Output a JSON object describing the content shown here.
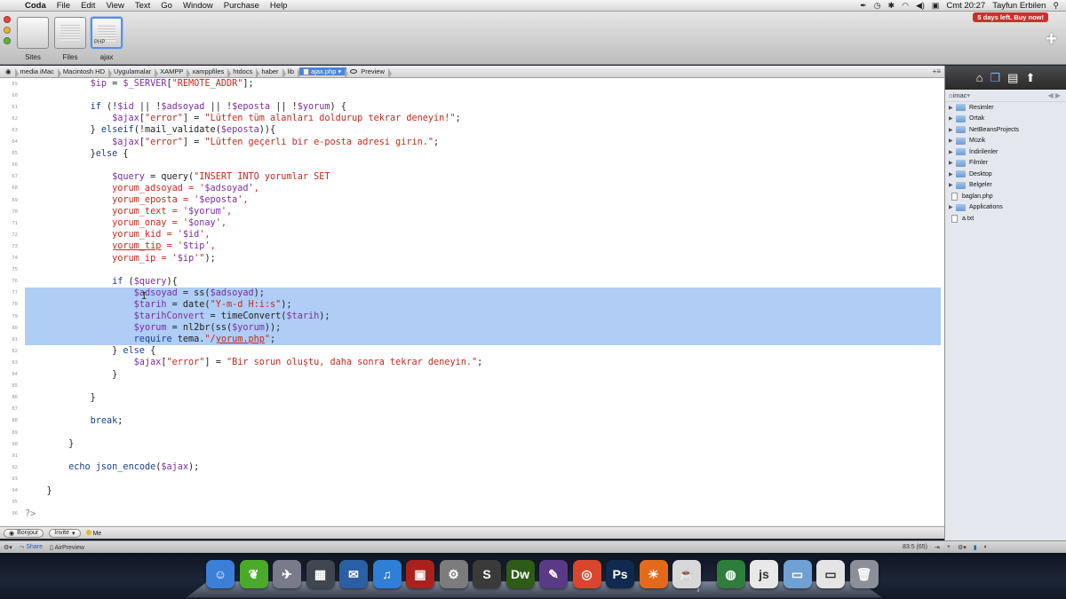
{
  "menubar": {
    "apple": "",
    "items": [
      "Coda",
      "File",
      "Edit",
      "View",
      "Text",
      "Go",
      "Window",
      "Purchase",
      "Help"
    ],
    "clock": "Cmt 20:27",
    "user": "Tayfun Erbilen"
  },
  "toolbar": {
    "sites": [
      {
        "label": "Sites"
      },
      {
        "label": "Files"
      },
      {
        "label": "ajax",
        "badge": "PHP"
      }
    ],
    "trial": "5 days left. Buy now!",
    "plus": "+"
  },
  "path": {
    "crumbs": [
      "media iMac",
      "Macintosh HD",
      "Uygulamalar",
      "XAMPP",
      "xamppfiles",
      "htdocs",
      "haber",
      "lib",
      "ajax.php"
    ],
    "preview": "Preview",
    "right": "+≡"
  },
  "editor": {
    "lines": [
      {
        "n": "59",
        "html": "            <span class=\"var\">$ip</span> = <span class=\"var\">$_SERVER</span>[<span class=\"str\">\"REMOTE_ADDR\"</span>];"
      },
      {
        "n": "60",
        "html": ""
      },
      {
        "n": "61",
        "html": "            <span class=\"kw\">if</span> (!<span class=\"var\">$id</span> || !<span class=\"var\">$adsoyad</span> || !<span class=\"var\">$eposta</span> || !<span class=\"var\">$yorum</span>) {"
      },
      {
        "n": "62",
        "html": "                <span class=\"var\">$ajax</span>[<span class=\"str\">\"error\"</span>] = <span class=\"str\">\"Lütfen tüm alanları doldurup tekrar deneyin!\"</span>;"
      },
      {
        "n": "63",
        "html": "            } <span class=\"kw\">elseif</span>(!mail_validate(<span class=\"var\">$eposta</span>)){"
      },
      {
        "n": "64",
        "html": "                <span class=\"var\">$ajax</span>[<span class=\"str\">\"error\"</span>] = <span class=\"str\">\"Lütfen geçerli bir e-posta adresi girin.\"</span>;"
      },
      {
        "n": "65",
        "html": "            }<span class=\"kw\">else</span> {"
      },
      {
        "n": "66",
        "html": ""
      },
      {
        "n": "67",
        "html": "                <span class=\"var\">$query</span> = query(<span class=\"str\">\"INSERT INTO yorumlar SET</span>"
      },
      {
        "n": "68",
        "html": "<span class=\"str\">                yorum_adsoyad = '</span><span class=\"var\">$adsoyad</span><span class=\"str\">',</span>"
      },
      {
        "n": "69",
        "html": "<span class=\"str\">                yorum_eposta = '</span><span class=\"var\">$eposta</span><span class=\"str\">',</span>"
      },
      {
        "n": "70",
        "html": "<span class=\"str\">                yorum_text = '</span><span class=\"var\">$yorum</span><span class=\"str\">',</span>"
      },
      {
        "n": "71",
        "html": "<span class=\"str\">                yorum_onay = '</span><span class=\"var\">$onay</span><span class=\"str\">',</span>"
      },
      {
        "n": "72",
        "html": "<span class=\"str\">                yorum_kid = '</span><span class=\"var\">$id</span><span class=\"str\">',</span>"
      },
      {
        "n": "73",
        "html": "<span class=\"str\">                <u>yorum_tip</u> = '</span><span class=\"var\">$tip</span><span class=\"str\">',</span>"
      },
      {
        "n": "74",
        "html": "<span class=\"str\">                yorum_ip = '</span><span class=\"var\">$ip</span><span class=\"str\">'\"</span>);"
      },
      {
        "n": "75",
        "html": ""
      },
      {
        "n": "76",
        "html": "                <span class=\"kw\">if</span> (<span class=\"var\">$query</span>){"
      },
      {
        "n": "77",
        "html": "                    <span class=\"var\">$adsoyad</span> = ss(<span class=\"var\">$adsoyad</span>);",
        "sel": true
      },
      {
        "n": "78",
        "html": "                    <span class=\"var\">$tarih</span> = date(<span class=\"str\">\"Y-m-d H:i:s\"</span>);",
        "sel": true
      },
      {
        "n": "79",
        "html": "                    <span class=\"var\">$tarihConvert</span> = timeConvert(<span class=\"var\">$tarih</span>);",
        "sel": true
      },
      {
        "n": "80",
        "html": "                    <span class=\"var\">$yorum</span> = nl2br(ss(<span class=\"var\">$yorum</span>));",
        "sel": true
      },
      {
        "n": "81",
        "html": "                    <span class=\"kw\">require</span> tema.<span class=\"str\">\"/<u>yorum.php</u>\"</span>;",
        "sel": true
      },
      {
        "n": "82",
        "html": "                } <span class=\"kw\">else</span> {"
      },
      {
        "n": "83",
        "html": "                    <span class=\"var\">$ajax</span>[<span class=\"str\">\"error\"</span>] = <span class=\"str\">\"Bir sorun oluştu, daha sonra tekrar deneyin.\"</span>;"
      },
      {
        "n": "84",
        "html": "                }"
      },
      {
        "n": "85",
        "html": ""
      },
      {
        "n": "86",
        "html": "            }"
      },
      {
        "n": "87",
        "html": ""
      },
      {
        "n": "88",
        "html": "            <span class=\"kw\">break</span>;"
      },
      {
        "n": "89",
        "html": ""
      },
      {
        "n": "90",
        "html": "        }"
      },
      {
        "n": "91",
        "html": ""
      },
      {
        "n": "92",
        "html": "        <span class=\"kw\">echo</span> <span class=\"kw\">json_encode</span>(<span class=\"var\">$ajax</span>);"
      },
      {
        "n": "93",
        "html": ""
      },
      {
        "n": "94",
        "html": "    }"
      },
      {
        "n": "95",
        "html": ""
      },
      {
        "n": "96",
        "html": "<span style=\"color:#888\">?&gt;</span>"
      }
    ]
  },
  "sidebar": {
    "location": "imac",
    "items": [
      {
        "label": "Resimler",
        "type": "folder"
      },
      {
        "label": "Ortak",
        "type": "folder"
      },
      {
        "label": "NetBeansProjects",
        "type": "folder"
      },
      {
        "label": "Müzik",
        "type": "folder"
      },
      {
        "label": "İndirilenler",
        "type": "folder"
      },
      {
        "label": "Filmler",
        "type": "folder"
      },
      {
        "label": "Desktop",
        "type": "folder"
      },
      {
        "label": "Belgeler",
        "type": "folder"
      },
      {
        "label": "baglan.php",
        "type": "file"
      },
      {
        "label": "Applications",
        "type": "folder"
      },
      {
        "label": "a.txt",
        "type": "file"
      }
    ]
  },
  "bottombar": {
    "bonjour": "Bonjour",
    "invite": "Invite",
    "me": "Me"
  },
  "statusbar": {
    "share": "Share",
    "airpreview": "AirPreview",
    "position": "83:5 (65)"
  },
  "dock": {
    "icons": [
      {
        "name": "finder",
        "color": "#3b7fd9",
        "glyph": "☺"
      },
      {
        "name": "leaf",
        "color": "#4caa2a",
        "glyph": "❦"
      },
      {
        "name": "launchpad",
        "color": "#777c88",
        "glyph": "✈"
      },
      {
        "name": "mission-control",
        "color": "#404650",
        "glyph": "▦"
      },
      {
        "name": "mail-bird",
        "color": "#2b5fa3",
        "glyph": "✉"
      },
      {
        "name": "itunes",
        "color": "#2f7fd6",
        "glyph": "♫"
      },
      {
        "name": "photobooth",
        "color": "#a8221d",
        "glyph": "▣"
      },
      {
        "name": "system-preferences",
        "color": "#7c7c7c",
        "glyph": "⚙"
      },
      {
        "name": "sublime",
        "color": "#3a3a3a",
        "glyph": "S"
      },
      {
        "name": "dreamweaver",
        "color": "#2e5b17",
        "glyph": "Dw"
      },
      {
        "name": "quill",
        "color": "#5a3a86",
        "glyph": "✎"
      },
      {
        "name": "chrome",
        "color": "#d9462e",
        "glyph": "◎"
      },
      {
        "name": "photoshop",
        "color": "#0f2a4e",
        "glyph": "Ps"
      },
      {
        "name": "firefox",
        "color": "#e36a1c",
        "glyph": "☀"
      },
      {
        "name": "java",
        "color": "#d8d8d8",
        "glyph": "☕"
      },
      {
        "name": "globe",
        "color": "#2f7d3d",
        "glyph": "◍"
      },
      {
        "name": "js-file",
        "color": "#e8e8e8",
        "glyph": "js"
      },
      {
        "name": "folder",
        "color": "#6fa1d4",
        "glyph": "▭"
      },
      {
        "name": "preview",
        "color": "#e4e4e4",
        "glyph": "▭"
      },
      {
        "name": "trash",
        "color": "#8a8f99",
        "glyph": "🗑"
      }
    ]
  }
}
